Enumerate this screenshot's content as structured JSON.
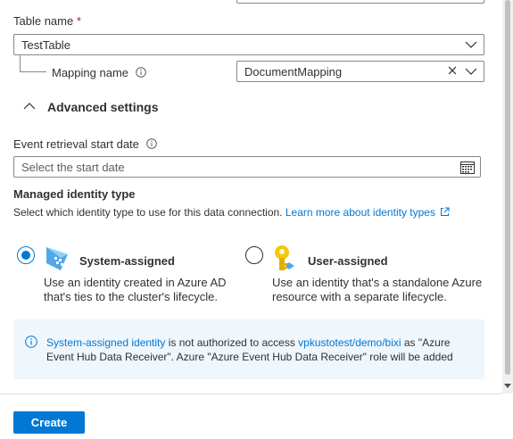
{
  "table_name": {
    "label": "Table name",
    "required_marker": "*",
    "value": "TestTable"
  },
  "mapping_name": {
    "label": "Mapping name",
    "value": "DocumentMapping"
  },
  "advanced_settings": {
    "label": "Advanced settings",
    "expanded": true
  },
  "event_retrieval": {
    "label": "Event retrieval start date",
    "placeholder": "Select the start date"
  },
  "managed_identity": {
    "title": "Managed identity type",
    "description": "Select which identity type to use for this data connection.",
    "learn_more": "Learn more about identity types",
    "options": [
      {
        "title": "System-assigned",
        "selected": true,
        "desc_line1": "Use an identity created in Azure AD",
        "desc_line2": "that's ties to the cluster's lifecycle."
      },
      {
        "title": "User-assigned",
        "selected": false,
        "desc_line1": "Use an identity that's a standalone Azure",
        "desc_line2": "resource with a separate lifecycle."
      }
    ]
  },
  "info": {
    "link1": "System-assigned identity",
    "text1": " is not authorized to access ",
    "link2": "vpkustotest/demo/bixi",
    "text2": " as \"Azure",
    "line2": "Event Hub Data Receiver\". Azure \"Azure Event Hub Data Receiver\" role will be added"
  },
  "footer": {
    "create_label": "Create"
  },
  "colors": {
    "accent": "#0078d4",
    "info_bg": "#eff6fc",
    "required": "#a4262c"
  }
}
